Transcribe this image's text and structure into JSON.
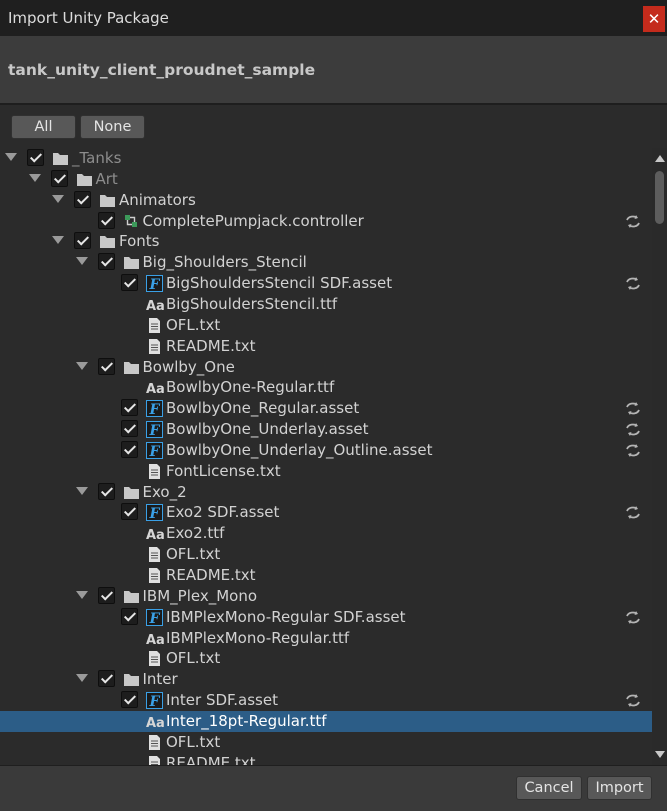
{
  "window": {
    "title": "Import Unity Package",
    "close_glyph": "✕"
  },
  "package": {
    "name": "tank_unity_client_proudnet_sample"
  },
  "selection_buttons": {
    "all_label": "All",
    "none_label": "None"
  },
  "footer": {
    "cancel_label": "Cancel",
    "import_label": "Import"
  },
  "colors": {
    "background": "#282828",
    "selected_row": "#2c5d87",
    "tmp_font_icon": "#3aa0e6",
    "close_button": "#c42b1c"
  },
  "tree": [
    {
      "label": "_Tanks",
      "depth": 0,
      "type": "folder",
      "expander": true,
      "checkbox": true,
      "checked": true,
      "dim": true
    },
    {
      "label": "Art",
      "depth": 1,
      "type": "folder",
      "expander": true,
      "checkbox": true,
      "checked": true,
      "dim": true
    },
    {
      "label": "Animators",
      "depth": 2,
      "type": "folder",
      "expander": true,
      "checkbox": true,
      "checked": true
    },
    {
      "label": "CompletePumpjack.controller",
      "depth": 3,
      "type": "animator-controller",
      "checkbox": true,
      "checked": true,
      "sync": true
    },
    {
      "label": "Fonts",
      "depth": 2,
      "type": "folder",
      "expander": true,
      "checkbox": true,
      "checked": true
    },
    {
      "label": "Big_Shoulders_Stencil",
      "depth": 3,
      "type": "folder",
      "expander": true,
      "checkbox": true,
      "checked": true
    },
    {
      "label": "BigShouldersStencil SDF.asset",
      "depth": 4,
      "type": "tmp-font-asset",
      "checkbox": true,
      "checked": true,
      "sync": true
    },
    {
      "label": "BigShouldersStencil.ttf",
      "depth": 4,
      "type": "font-file"
    },
    {
      "label": "OFL.txt",
      "depth": 4,
      "type": "text-file"
    },
    {
      "label": "README.txt",
      "depth": 4,
      "type": "text-file"
    },
    {
      "label": "Bowlby_One",
      "depth": 3,
      "type": "folder",
      "expander": true,
      "checkbox": true,
      "checked": true
    },
    {
      "label": "BowlbyOne-Regular.ttf",
      "depth": 4,
      "type": "font-file"
    },
    {
      "label": "BowlbyOne_Regular.asset",
      "depth": 4,
      "type": "tmp-font-asset",
      "checkbox": true,
      "checked": true,
      "sync": true
    },
    {
      "label": "BowlbyOne_Underlay.asset",
      "depth": 4,
      "type": "tmp-font-asset",
      "checkbox": true,
      "checked": true,
      "sync": true
    },
    {
      "label": "BowlbyOne_Underlay_Outline.asset",
      "depth": 4,
      "type": "tmp-font-asset",
      "checkbox": true,
      "checked": true,
      "sync": true
    },
    {
      "label": "FontLicense.txt",
      "depth": 4,
      "type": "text-file"
    },
    {
      "label": "Exo_2",
      "depth": 3,
      "type": "folder",
      "expander": true,
      "checkbox": true,
      "checked": true
    },
    {
      "label": "Exo2 SDF.asset",
      "depth": 4,
      "type": "tmp-font-asset",
      "checkbox": true,
      "checked": true,
      "sync": true
    },
    {
      "label": "Exo2.ttf",
      "depth": 4,
      "type": "font-file"
    },
    {
      "label": "OFL.txt",
      "depth": 4,
      "type": "text-file"
    },
    {
      "label": "README.txt",
      "depth": 4,
      "type": "text-file"
    },
    {
      "label": "IBM_Plex_Mono",
      "depth": 3,
      "type": "folder",
      "expander": true,
      "checkbox": true,
      "checked": true
    },
    {
      "label": "IBMPlexMono-Regular SDF.asset",
      "depth": 4,
      "type": "tmp-font-asset",
      "checkbox": true,
      "checked": true,
      "sync": true
    },
    {
      "label": "IBMPlexMono-Regular.ttf",
      "depth": 4,
      "type": "font-file"
    },
    {
      "label": "OFL.txt",
      "depth": 4,
      "type": "text-file"
    },
    {
      "label": "Inter",
      "depth": 3,
      "type": "folder",
      "expander": true,
      "checkbox": true,
      "checked": true
    },
    {
      "label": "Inter SDF.asset",
      "depth": 4,
      "type": "tmp-font-asset",
      "checkbox": true,
      "checked": true,
      "sync": true
    },
    {
      "label": "Inter_18pt-Regular.ttf",
      "depth": 4,
      "type": "font-file",
      "selected": true
    },
    {
      "label": "OFL.txt",
      "depth": 4,
      "type": "text-file"
    },
    {
      "label": "README.txt",
      "depth": 4,
      "type": "text-file"
    }
  ]
}
